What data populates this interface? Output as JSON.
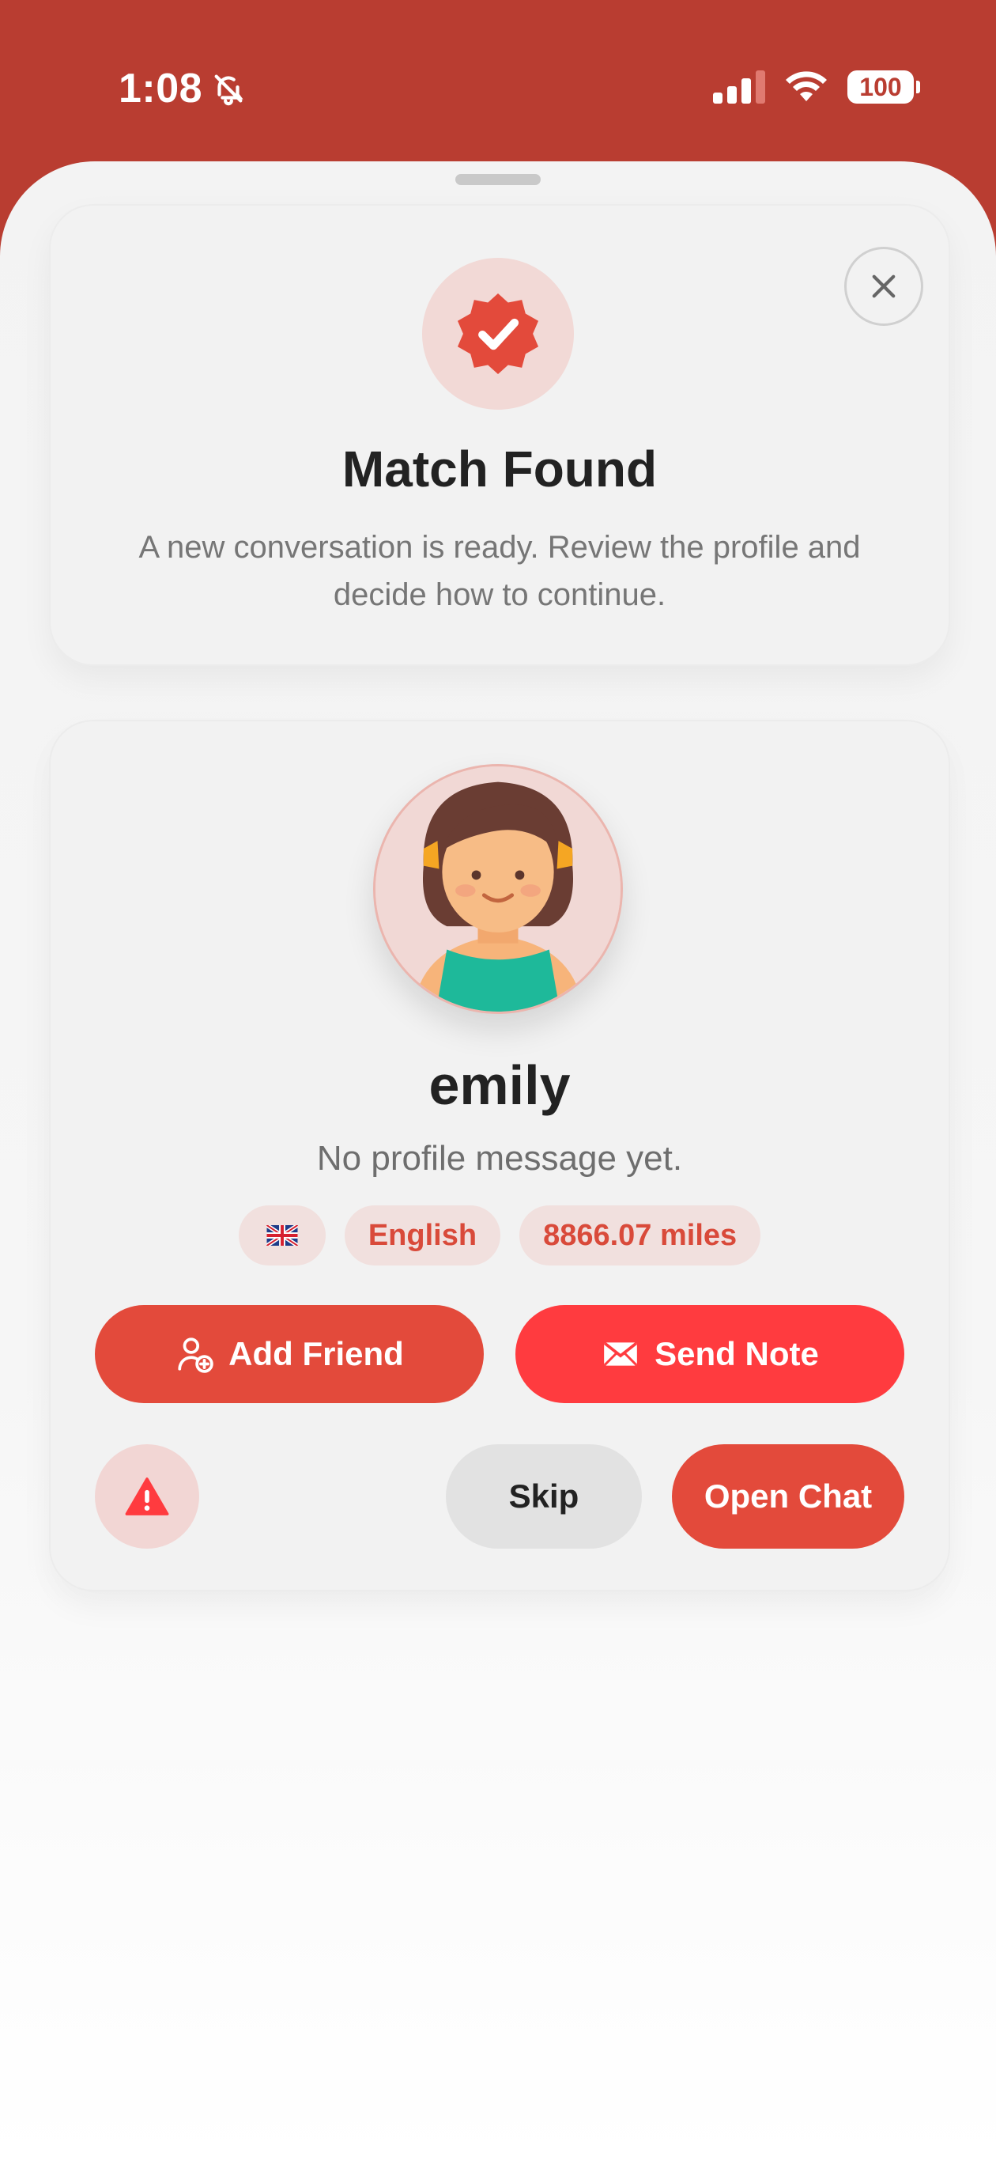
{
  "status_bar": {
    "time": "1:08",
    "battery": "100"
  },
  "match_card": {
    "title": "Match Found",
    "subtitle": "A new conversation is ready. Review the profile and decide how to continue."
  },
  "profile": {
    "name": "emily",
    "message": "No profile message yet.",
    "flag_icon": "uk-flag-icon",
    "language": "English",
    "distance": "8866.07 miles"
  },
  "actions": {
    "add_friend": "Add Friend",
    "send_note": "Send Note",
    "skip": "Skip",
    "open_chat": "Open Chat"
  },
  "colors": {
    "header": "#B93D31",
    "accent": "#E34A3B",
    "note_red": "#FF3B3F",
    "chip_bg": "#F1E0DE"
  }
}
